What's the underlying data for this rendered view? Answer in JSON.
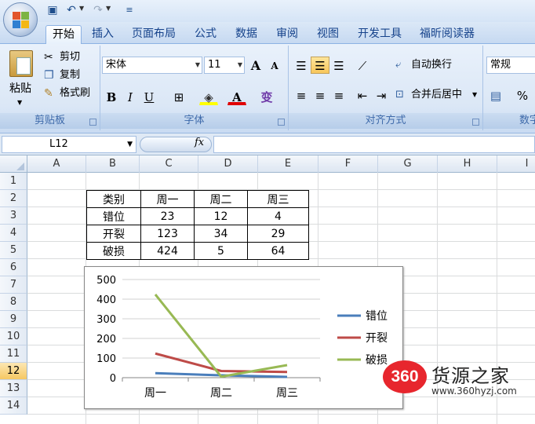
{
  "tabs": [
    "开始",
    "插入",
    "页面布局",
    "公式",
    "数据",
    "审阅",
    "视图",
    "开发工具",
    "福昕阅读器"
  ],
  "clipboard": {
    "paste": "粘贴",
    "cut": "剪切",
    "copy": "复制",
    "format_painter": "格式刷",
    "label": "剪贴板"
  },
  "font": {
    "name": "宋体",
    "size": "11",
    "grow": "A",
    "shrink": "A",
    "bold": "B",
    "italic": "I",
    "underline": "U",
    "font_color": "A",
    "phonetic": "变",
    "label": "字体"
  },
  "alignment": {
    "wrap_text": "自动换行",
    "merge_center": "合并后居中",
    "label": "对齐方式"
  },
  "number": {
    "format": "常规",
    "percent": "%",
    "label": "数字"
  },
  "formula_bar": {
    "name_box": "L12",
    "fx": "fx",
    "content": ""
  },
  "columns": [
    "A",
    "B",
    "C",
    "D",
    "E",
    "F",
    "G",
    "H",
    "I"
  ],
  "rows": [
    "1",
    "2",
    "3",
    "4",
    "5",
    "6",
    "7",
    "8",
    "9",
    "10",
    "11",
    "12",
    "13",
    "14"
  ],
  "selected_row": "12",
  "table": [
    [
      "类别",
      "周一",
      "周二",
      "周三"
    ],
    [
      "错位",
      "23",
      "12",
      "4"
    ],
    [
      "开裂",
      "123",
      "34",
      "29"
    ],
    [
      "破损",
      "424",
      "5",
      "64"
    ]
  ],
  "chart_data": {
    "type": "line",
    "categories": [
      "周一",
      "周二",
      "周三"
    ],
    "series": [
      {
        "name": "错位",
        "values": [
          23,
          12,
          4
        ],
        "color": "#4a7ebb"
      },
      {
        "name": "开裂",
        "values": [
          123,
          34,
          29
        ],
        "color": "#be4b48"
      },
      {
        "name": "破损",
        "values": [
          424,
          5,
          64
        ],
        "color": "#98b954"
      }
    ],
    "ylim": [
      0,
      500
    ],
    "yticks": [
      0,
      100,
      200,
      300,
      400,
      500
    ],
    "grid": true,
    "legend": "right"
  },
  "watermark": {
    "badge": "360",
    "title": "货源之家",
    "url": "www.360hyzj.com"
  }
}
